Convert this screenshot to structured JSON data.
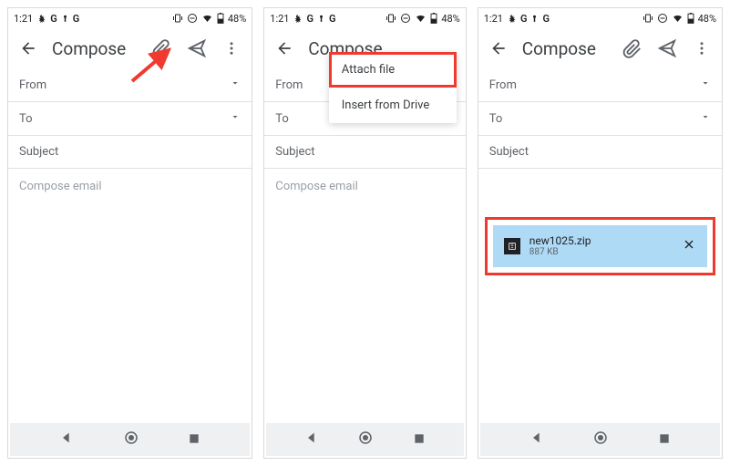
{
  "status": {
    "time": "1:21",
    "battery": "48%"
  },
  "compose": {
    "title": "Compose",
    "from_label": "From",
    "to_label": "To",
    "subject_label": "Subject",
    "body_placeholder": "Compose email"
  },
  "menu": {
    "attach_file": "Attach file",
    "insert_drive": "Insert from Drive"
  },
  "attachment": {
    "name": "new1025.zip",
    "size": "887 KB"
  }
}
